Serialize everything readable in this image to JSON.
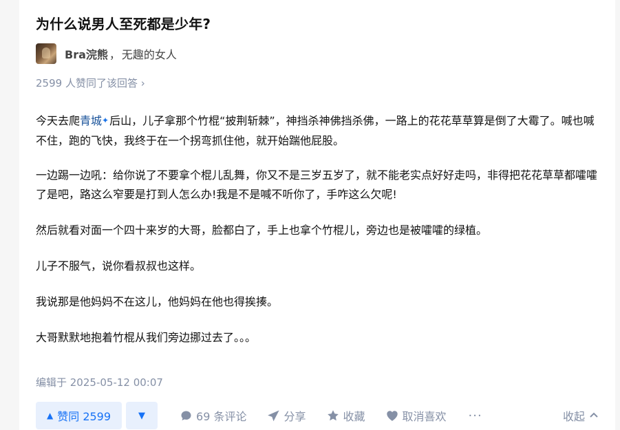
{
  "question": {
    "title": "为什么说男人至死都是少年?"
  },
  "author": {
    "name": "Bra浣熊",
    "bio": "无趣的女人",
    "separator": "，"
  },
  "votes_summary": "2599 人赞同了该回答",
  "votes_summary_chevron": "›",
  "answer": {
    "p1_prefix": "今天去爬",
    "p1_link": "青城",
    "p1_rest": "后山，儿子拿那个竹棍“披荆斩棘”，神挡杀神佛挡杀佛，一路上的花花草草算是倒了大霉了。喊也喊不住，跑的飞快，我终于在一个拐弯抓住他，就开始踹他屁股。",
    "paragraphs": [
      "一边踢一边吼：给你说了不要拿个棍儿乱舞，你又不是三岁五岁了，就不能老实点好好走吗，非得把花花草草都嚯嚯了是吧，路这么窄要是打到人怎么办!我是不是喊不听你了，手咋这么欠呢!",
      "然后就看对面一个四十来岁的大哥，脸都白了，手上也拿个竹棍儿，旁边也是被嚯嚯的绿植。",
      "儿子不服气，说你看叔叔也这样。",
      "我说那是他妈妈不在这儿，他妈妈在他也得挨揍。",
      "大哥默默地抱着竹棍从我们旁边挪过去了。。。"
    ]
  },
  "edited": "编辑于 2025-05-12 00:07",
  "actions": {
    "upvote": "赞同 2599",
    "comments": "69 条评论",
    "share": "分享",
    "favorite": "收藏",
    "unlike": "取消喜欢",
    "more": "···",
    "collapse": "收起"
  },
  "colors": {
    "accent": "#1772f6",
    "accent_bg": "#e8f0fd",
    "muted": "#8590a6",
    "link": "#175199"
  }
}
